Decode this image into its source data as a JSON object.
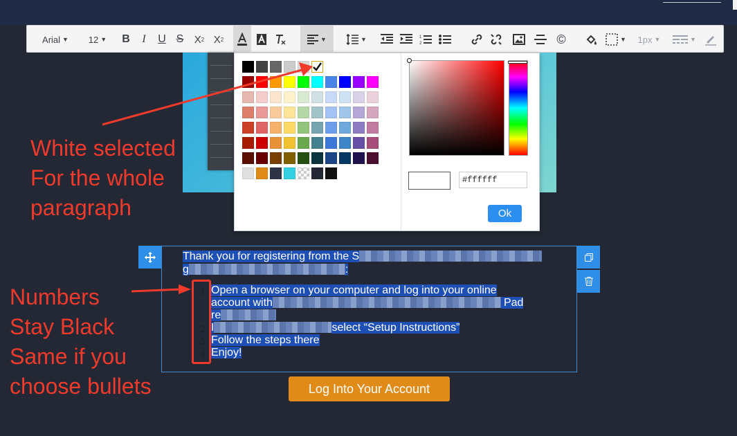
{
  "toolbar": {
    "font_family": "Arial",
    "font_size": "12",
    "border_width": "1px"
  },
  "color_picker": {
    "hex_value": "#ffffff",
    "ok_label": "Ok",
    "selected_swatch": "#ffffff",
    "rows": [
      [
        "#000000",
        "#434343",
        "#666666",
        "#cccccc",
        "#d9d9d9",
        "#ffffff"
      ],
      [
        "#980000",
        "#ff0000",
        "#ff9900",
        "#ffff00",
        "#00ff00",
        "#00ffff",
        "#4a86e8",
        "#0000ff",
        "#9900ff",
        "#ff00ff"
      ],
      [
        "#e6b8af",
        "#f4cccc",
        "#fce5cd",
        "#fff2cc",
        "#d9ead3",
        "#d0e0e3",
        "#c9daf8",
        "#cfe2f3",
        "#d9d2e9",
        "#ead1dc"
      ],
      [
        "#dd7e6b",
        "#ea9999",
        "#f9cb9c",
        "#ffe599",
        "#b6d7a8",
        "#a2c4c9",
        "#a4c2f4",
        "#9fc5e8",
        "#b4a7d6",
        "#d5a6bd"
      ],
      [
        "#cc4125",
        "#e06666",
        "#f6b26b",
        "#ffd966",
        "#93c47d",
        "#76a5af",
        "#6d9eeb",
        "#6fa8dc",
        "#8e7cc3",
        "#c27ba0"
      ],
      [
        "#a61c00",
        "#cc0000",
        "#e69138",
        "#f1c232",
        "#6aa84f",
        "#45818e",
        "#3c78d8",
        "#3d85c6",
        "#674ea7",
        "#a64d79"
      ],
      [
        "#5b0f00",
        "#660000",
        "#783f04",
        "#7f6000",
        "#274e13",
        "#0c343d",
        "#1c4587",
        "#073763",
        "#20124d",
        "#4c1130"
      ],
      [
        "#e0e0e0",
        "#e08b18",
        "#2e3446",
        "#33d1e2",
        "transparent",
        "#232834",
        "#111111"
      ]
    ]
  },
  "annotations": {
    "white_selected": [
      "White selected",
      "For the whole",
      "paragraph"
    ],
    "numbers_black": [
      "Numbers",
      "Stay Black",
      "Same if you",
      "choose bullets"
    ]
  },
  "content": {
    "intro_line1": "Thank you for registering from the S",
    "intro_line2": "g",
    "intro_line2_end": ":",
    "steps": [
      {
        "num": "1",
        "lines": [
          "Open a browser on your computer and log into your online",
          "account with",
          "re"
        ],
        "tail": "Pad"
      },
      {
        "num": "2",
        "lines": [
          "I",
          "select “Setup Instructions”"
        ]
      },
      {
        "num": "3",
        "lines": [
          "Follow the steps there"
        ]
      },
      {
        "num": "4",
        "lines": [
          "Enjoy!"
        ]
      }
    ],
    "login_button": "Log Into Your Account"
  },
  "colors": {
    "accent": "#2f8ee8",
    "annotation": "#f03a2c",
    "button": "#e08b18"
  }
}
